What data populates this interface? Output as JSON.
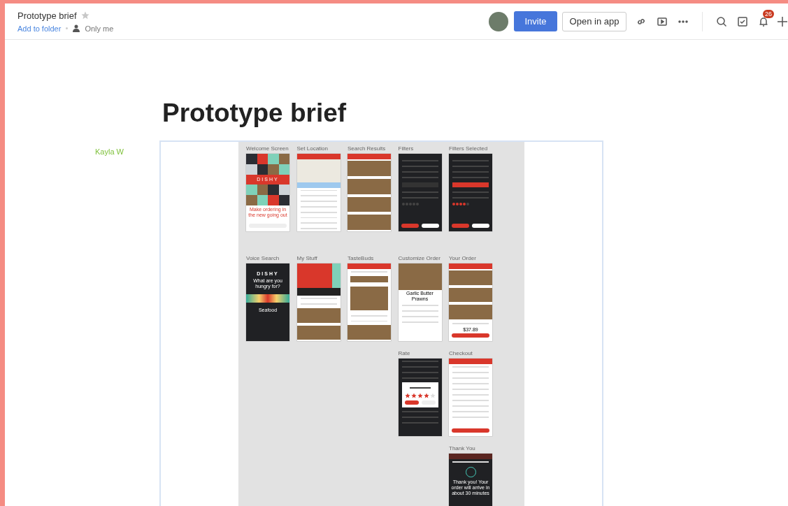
{
  "header": {
    "title": "Prototype brief",
    "starred": false,
    "folder_link": "Add to folder",
    "sharing": "Only me",
    "invite_button": "Invite",
    "open_button": "Open in app",
    "notification_count": "26"
  },
  "document": {
    "title": "Prototype brief",
    "author": "Kayla W",
    "rows": [
      {
        "screens": [
          {
            "label": "Welcome Screen",
            "kind": "welcome",
            "texts": [
              "DISHY",
              "Make ordering in the new going out"
            ]
          },
          {
            "label": "Set Location",
            "kind": "map"
          },
          {
            "label": "Search Results",
            "kind": "photos"
          },
          {
            "label": "Filters",
            "kind": "filters"
          },
          {
            "label": "Filters Selected",
            "kind": "filters-selected"
          }
        ]
      },
      {
        "screens": [
          {
            "label": "Voice Search",
            "kind": "voice",
            "texts": [
              "DISHY",
              "What are you hungry for?",
              "Seafood"
            ]
          },
          {
            "label": "My Stuff",
            "kind": "profile"
          },
          {
            "label": "TasteBuds",
            "kind": "feed"
          },
          {
            "label": "Customize Order",
            "kind": "detail",
            "texts": [
              "Garlic Butter Prawns"
            ]
          },
          {
            "label": "Your Order",
            "kind": "order",
            "texts": [
              "$37.89"
            ]
          }
        ]
      },
      {
        "screens": [
          {
            "label": "Rate",
            "kind": "rate",
            "stars": 4
          },
          {
            "label": "Checkout",
            "kind": "checkout"
          }
        ]
      },
      {
        "screens": [
          {
            "label": "Thank You",
            "kind": "thanks",
            "texts": [
              "Thank you! Your order will arrive in about 30 minutes"
            ]
          }
        ]
      }
    ]
  }
}
